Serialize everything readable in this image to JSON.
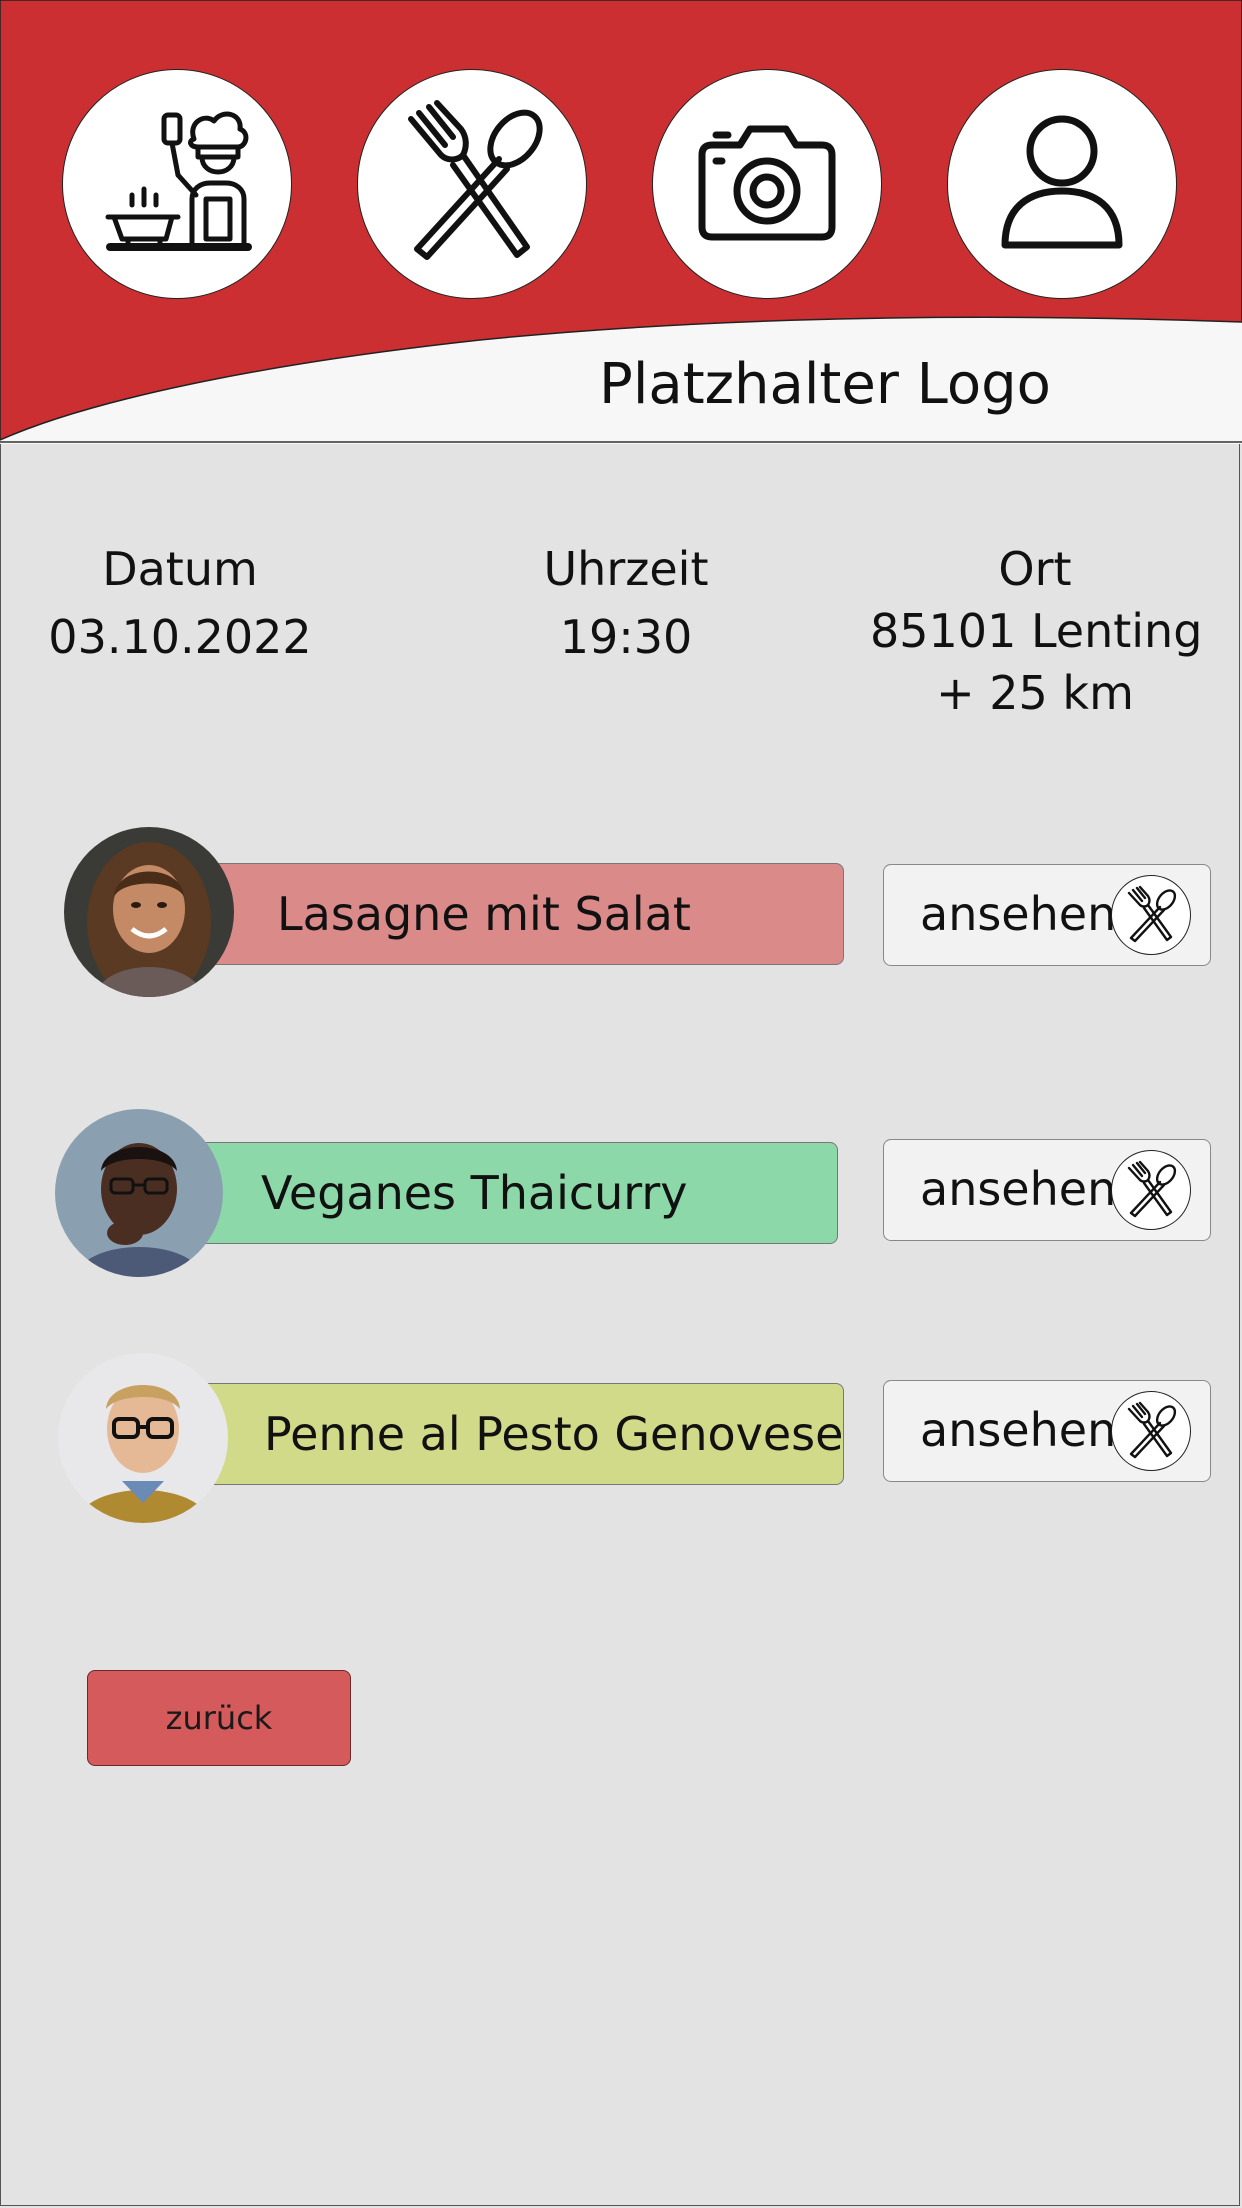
{
  "header": {
    "logo_text": "Platzhalter Logo",
    "brand_color": "#cc2f31",
    "nav": [
      {
        "icon": "chef-cooking-icon"
      },
      {
        "icon": "fork-spoon-icon"
      },
      {
        "icon": "camera-icon"
      },
      {
        "icon": "user-icon"
      }
    ]
  },
  "info": {
    "date_label": "Datum",
    "date_value": "03.10.2022",
    "time_label": "Uhrzeit",
    "time_value": "19:30",
    "place_label": "Ort",
    "place_value": "85101 Lenting",
    "radius_value": "+ 25 km"
  },
  "dishes": [
    {
      "title": "Lasagne mit Salat",
      "color": "#db8a8a",
      "view_label": "ansehen",
      "view_icon": "fork-spoon-icon"
    },
    {
      "title": "Veganes Thaicurry",
      "color": "#8cd8a8",
      "view_label": "ansehen",
      "view_icon": "fork-spoon-icon"
    },
    {
      "title": "Penne al Pesto Genovese",
      "color": "#d0da88",
      "view_label": "ansehen",
      "view_icon": "fork-spoon-icon"
    }
  ],
  "back_label": "zurück"
}
